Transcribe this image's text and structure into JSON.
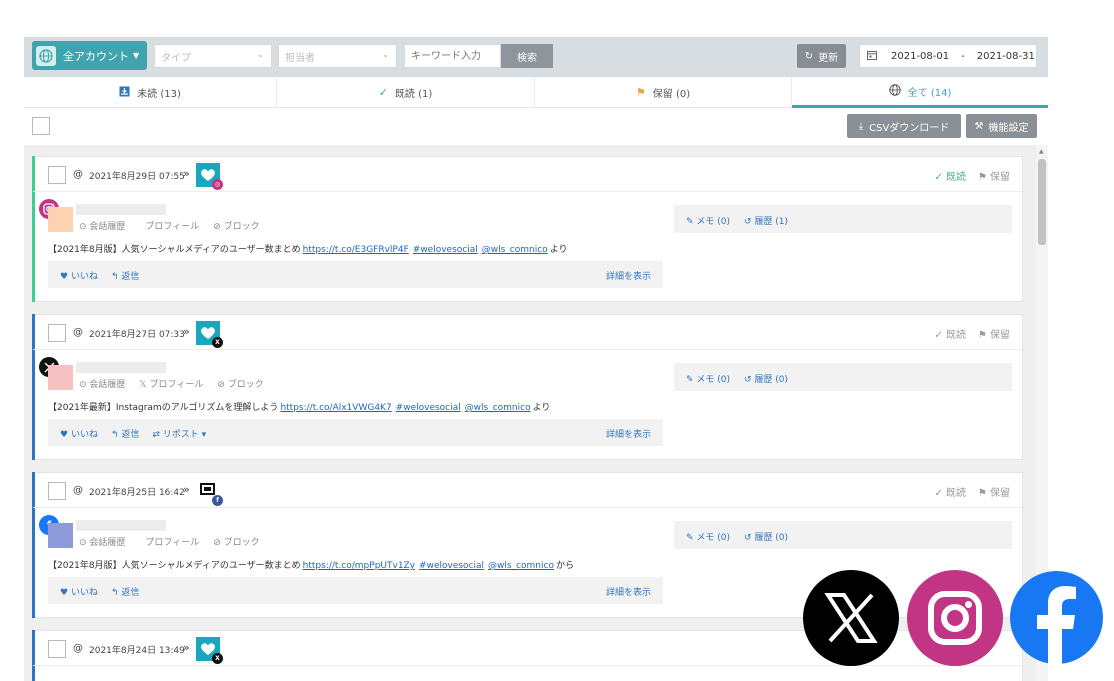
{
  "toolbar": {
    "account_label": "全アカウント",
    "type_placeholder": "タイプ",
    "assignee_placeholder": "担当者",
    "keyword_placeholder": "キーワード入力",
    "search_label": "検索",
    "refresh_label": "更新",
    "date_from": "2021-08-01",
    "date_sep": "-",
    "date_to": "2021-08-31"
  },
  "tabs": [
    {
      "label": "未読 (13)",
      "icon": "inbox-icon"
    },
    {
      "label": "既読 (1)",
      "icon": "check-icon"
    },
    {
      "label": "保留 (0)",
      "icon": "flag-icon"
    },
    {
      "label": "全て (14)",
      "icon": "globe-icon"
    }
  ],
  "actions": {
    "csv_label": "CSVダウンロード",
    "settings_label": "機能設定"
  },
  "common": {
    "at": "@",
    "read": "既読",
    "hold": "保留",
    "conversation": "会話履歴",
    "profile": "プロフィール",
    "block": "ブロック",
    "like": "いいね",
    "reply": "返信",
    "repost": "リポスト",
    "detail": "詳細を表示"
  },
  "cards": [
    {
      "date": "2021年8月29日 07:55",
      "network": "instagram",
      "is_read": true,
      "accent": "#3fcf8e",
      "avatar_color": "#fbd3b0",
      "text_prefix": "【2021年8月版】人気ソーシャルメディアのユーザー数まとめ",
      "link": "https://t.co/E3GFRvlP4F",
      "tag": "#welovesocial",
      "mention": "@wls_comnico",
      "text_suffix": "より",
      "memo": "メモ (0)",
      "history": "履歴 (1)"
    },
    {
      "date": "2021年8月27日 07:33",
      "network": "x",
      "is_read": false,
      "accent": "#2f74c0",
      "avatar_color": "#f6c1c1",
      "text_prefix": "【2021年最新】Instagramのアルゴリズムを理解しよう",
      "link": "https://t.co/Alx1VWG4K7",
      "tag": "#welovesocial",
      "mention": "@wls_comnico",
      "text_suffix": "より",
      "memo": "メモ (0)",
      "history": "履歴 (0)"
    },
    {
      "date": "2021年8月25日 16:42",
      "network": "facebook",
      "is_read": false,
      "accent": "#2f74c0",
      "avatar_color": "#8e9bd8",
      "text_prefix": "【2021年8月版】人気ソーシャルメディアのユーザー数まとめ",
      "link": "https://t.co/mpPpUTv1Zy",
      "tag": "#welovesocial",
      "mention": "@wls_comnico",
      "text_suffix": "から",
      "memo": "メモ (0)",
      "history": "履歴 (0)"
    },
    {
      "date": "2021年8月24日 13:49",
      "network": "x",
      "is_read": false,
      "accent": "#2f74c0"
    }
  ]
}
